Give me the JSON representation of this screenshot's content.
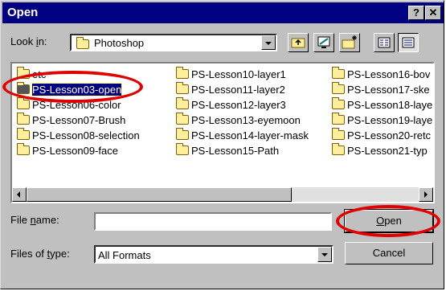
{
  "window": {
    "title": "Open",
    "help_glyph": "?",
    "close_glyph": "✕"
  },
  "lookin": {
    "label_prefix": "Look ",
    "label_accel": "i",
    "label_suffix": "n:",
    "value": "Photoshop"
  },
  "toolbar": {
    "buttons": [
      "up-one-level",
      "go-to-desktop",
      "create-new-folder",
      "list-view",
      "details-view"
    ]
  },
  "files": [
    "etc",
    "PS-Lesson03-open",
    "PS-Lesson06-color",
    "PS-Lesson07-Brush",
    "PS-Lesson08-selection",
    "PS-Lesson09-face",
    "PS-Lesson10-layer1",
    "PS-Lesson11-layer2",
    "PS-Lesson12-layer3",
    "PS-Lesson13-eyemoon",
    "PS-Lesson14-layer-mask",
    "PS-Lesson15-Path",
    "PS-Lesson16-bov",
    "PS-Lesson17-ske",
    "PS-Lesson18-laye",
    "PS-Lesson19-laye",
    "PS-Lesson20-retc",
    "PS-Lesson21-typ"
  ],
  "selected_file": "PS-Lesson03-open",
  "filename": {
    "label_prefix": "File ",
    "label_accel": "n",
    "label_suffix": "ame:",
    "value": ""
  },
  "filetype": {
    "label_prefix": "Files of ",
    "label_accel": "t",
    "label_suffix": "ype:",
    "value": "All Formats"
  },
  "buttons": {
    "open_accel": "O",
    "open_rest": "pen",
    "cancel": "Cancel"
  },
  "colors": {
    "titlebar": "#000080",
    "highlight_ring": "#e00000",
    "dialog_face": "#c0c0c0"
  }
}
